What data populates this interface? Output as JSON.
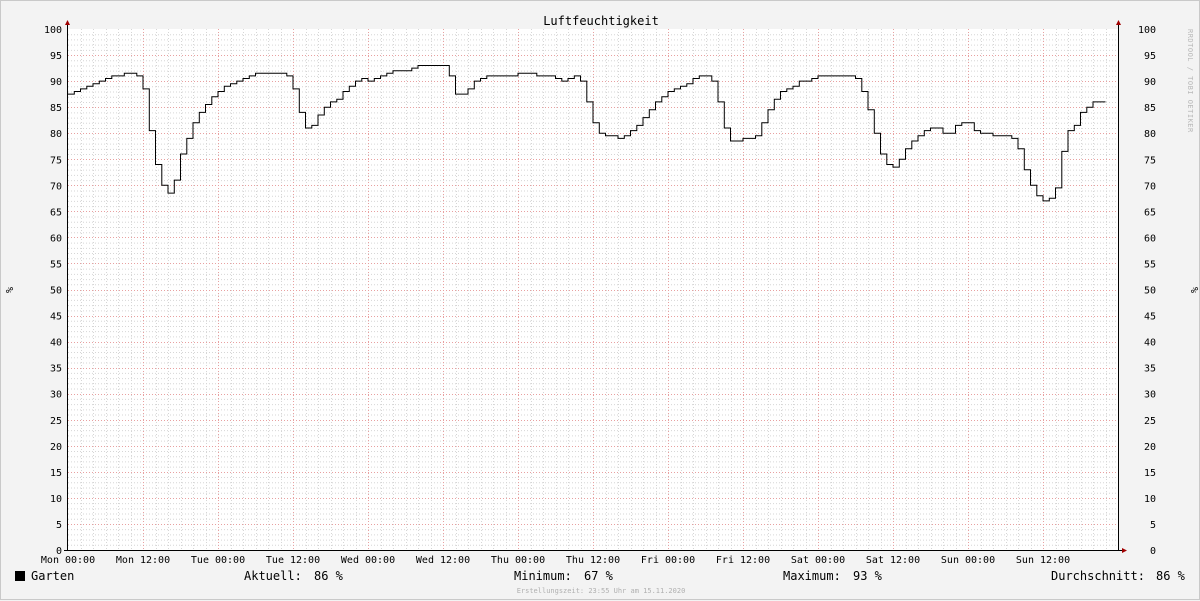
{
  "chart_data": {
    "type": "line",
    "title": "Luftfeuchtigkeit",
    "ylabel": "%",
    "ylim": [
      0,
      100
    ],
    "y_ticks": [
      0,
      5,
      10,
      15,
      20,
      25,
      30,
      35,
      40,
      45,
      50,
      55,
      60,
      65,
      70,
      75,
      80,
      85,
      90,
      95,
      100
    ],
    "x_tick_hours": [
      0,
      12,
      24,
      36,
      48,
      60,
      72,
      84,
      96,
      108,
      120,
      132,
      144,
      156
    ],
    "x_tick_labels": [
      "Mon 00:00",
      "Mon 12:00",
      "Tue 00:00",
      "Tue 12:00",
      "Wed 00:00",
      "Wed 12:00",
      "Thu 00:00",
      "Thu 12:00",
      "Fri 00:00",
      "Fri 12:00",
      "Sat 00:00",
      "Sat 12:00",
      "Sun 00:00",
      "Sun 12:00"
    ],
    "grid": true,
    "legend": "bottom-left",
    "line_color": "#000000",
    "series": [
      {
        "name": "Garten",
        "x_hours": [
          0,
          1,
          2,
          3,
          4,
          5,
          6,
          7,
          8,
          9,
          10,
          11,
          12,
          13,
          14,
          15,
          16,
          17,
          18,
          19,
          20,
          21,
          22,
          23,
          24,
          25,
          26,
          27,
          28,
          29,
          30,
          31,
          32,
          33,
          34,
          35,
          36,
          37,
          38,
          39,
          40,
          41,
          42,
          43,
          44,
          45,
          46,
          47,
          48,
          49,
          50,
          51,
          52,
          53,
          54,
          55,
          56,
          57,
          58,
          59,
          60,
          61,
          62,
          63,
          64,
          65,
          66,
          67,
          68,
          69,
          70,
          71,
          72,
          73,
          74,
          75,
          76,
          77,
          78,
          79,
          80,
          81,
          82,
          83,
          84,
          85,
          86,
          87,
          88,
          89,
          90,
          91,
          92,
          93,
          94,
          95,
          96,
          97,
          98,
          99,
          100,
          101,
          102,
          103,
          104,
          105,
          106,
          107,
          108,
          109,
          110,
          111,
          112,
          113,
          114,
          115,
          116,
          117,
          118,
          119,
          120,
          121,
          122,
          123,
          124,
          125,
          126,
          127,
          128,
          129,
          130,
          131,
          132,
          133,
          134,
          135,
          136,
          137,
          138,
          139,
          140,
          141,
          142,
          143,
          144,
          145,
          146,
          147,
          148,
          149,
          150,
          151,
          152,
          153,
          154,
          155,
          156,
          157,
          158,
          159,
          160,
          161,
          162,
          163,
          164,
          165,
          166
        ],
        "values": [
          87.5,
          88,
          88.5,
          89,
          89.5,
          90,
          90.5,
          91,
          91,
          91.5,
          91.5,
          91,
          88.5,
          80.5,
          74,
          70,
          68.5,
          71,
          76,
          79,
          82,
          84,
          85.5,
          87,
          88,
          89,
          89.5,
          90,
          90.5,
          91,
          91.5,
          91.5,
          91.5,
          91.5,
          91.5,
          91,
          88.5,
          84,
          81,
          81.5,
          83.5,
          85,
          86,
          86.5,
          88,
          89,
          90,
          90.5,
          90,
          90.5,
          91,
          91.5,
          92,
          92,
          92,
          92.5,
          93,
          93,
          93,
          93,
          93,
          91,
          87.5,
          87.5,
          88.5,
          90,
          90.5,
          91,
          91,
          91,
          91,
          91,
          91.5,
          91.5,
          91.5,
          91,
          91,
          91,
          90.5,
          90,
          90.5,
          91,
          90,
          86,
          82,
          80,
          79.5,
          79.5,
          79,
          79.5,
          80.5,
          81.5,
          83,
          84.5,
          86,
          87,
          88,
          88.5,
          89,
          89.5,
          90.5,
          91,
          91,
          90,
          86,
          81,
          78.5,
          78.5,
          79,
          79,
          79.5,
          82,
          84.5,
          86.5,
          88,
          88.5,
          89,
          90,
          90,
          90.5,
          91,
          91,
          91,
          91,
          91,
          91,
          90.5,
          88,
          84.5,
          80,
          76,
          74,
          73.5,
          75,
          77,
          78.5,
          79.5,
          80.5,
          81,
          81,
          80,
          80,
          81.5,
          82,
          82,
          80.5,
          80,
          80,
          79.5,
          79.5,
          79.5,
          79,
          77,
          73,
          70,
          68,
          67,
          67.5,
          69.5,
          76.5,
          80.5,
          81.5,
          84,
          85,
          86,
          86
        ]
      }
    ],
    "legend_entries": [
      {
        "name": "Garten",
        "color": "#000000"
      }
    ],
    "stats": {
      "current_label": "Aktuell:",
      "current_value": "86 %",
      "min_label": "Minimum:",
      "min_value": "67 %",
      "max_label": "Maximum:",
      "max_value": "93 %",
      "avg_label": "Durchschnitt:",
      "avg_value": "86 %"
    },
    "watermark": "RRDTOOL / TOBI OETIKER",
    "footer": "Erstellungszeit: 23:55 Uhr am 15.11.2020"
  }
}
